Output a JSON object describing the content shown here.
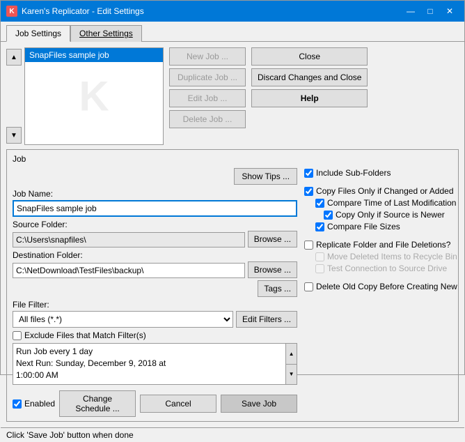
{
  "window": {
    "title": "Karen's Replicator - Edit Settings",
    "icon": "K",
    "controls": {
      "minimize": "—",
      "maximize": "□",
      "close": "✕"
    }
  },
  "tabs": [
    {
      "id": "job-settings",
      "label": "Job Settings",
      "active": true
    },
    {
      "id": "other-settings",
      "label": "Other Settings",
      "active": false,
      "underline": true
    }
  ],
  "job_list": {
    "items": [
      {
        "label": "SnapFiles sample job",
        "selected": true
      }
    ]
  },
  "scroll_arrows": {
    "up": "▲",
    "down": "▼"
  },
  "top_buttons_left": {
    "new_job": "New Job ...",
    "duplicate_job": "Duplicate Job ...",
    "edit_job": "Edit Job ...",
    "delete_job": "Delete Job ..."
  },
  "top_buttons_right": {
    "close": "Close",
    "discard_close": "Discard Changes and Close",
    "help": "Help"
  },
  "job_section": {
    "title": "Job",
    "show_tips": "Show Tips ...",
    "job_name_label": "Job Name:",
    "job_name_value": "SnapFiles sample job",
    "source_folder_label": "Source Folder:",
    "source_folder_value": "C:\\Users\\snapfiles\\",
    "browse_source": "Browse ...",
    "destination_folder_label": "Destination Folder:",
    "destination_folder_value": "C:\\NetDownload\\TestFiles\\backup\\",
    "browse_dest": "Browse ...",
    "tags": "Tags ...",
    "file_filter_label": "File Filter:",
    "file_filter_value": "All files (*.*)",
    "edit_filters": "Edit Filters ...",
    "exclude_label": "Exclude Files that Match Filter(s)",
    "schedule_text_line1": "Run Job every 1 day",
    "schedule_text_line2": "Next Run: Sunday, December 9, 2018 at",
    "schedule_text_line3": "1:00:00 AM",
    "enabled_label": "Enabled",
    "change_schedule": "Change Schedule ...",
    "cancel": "Cancel",
    "save_job": "Save Job"
  },
  "right_options": {
    "include_subfolders_label": "Include Sub-Folders",
    "copy_files_label": "Copy Files Only if Changed or Added",
    "compare_time_label": "Compare Time of Last Modification",
    "copy_newer_label": "Copy Only if Source is Newer",
    "compare_sizes_label": "Compare File Sizes",
    "replicate_deletions_label": "Replicate Folder and File Deletions?",
    "move_deleted_label": "Move Deleted Items to Recycle Bin",
    "test_connection_label": "Test Connection to Source Drive",
    "delete_old_copy_label": "Delete Old Copy Before Creating New"
  },
  "status_bar": {
    "text": "Click 'Save Job' button when done"
  }
}
